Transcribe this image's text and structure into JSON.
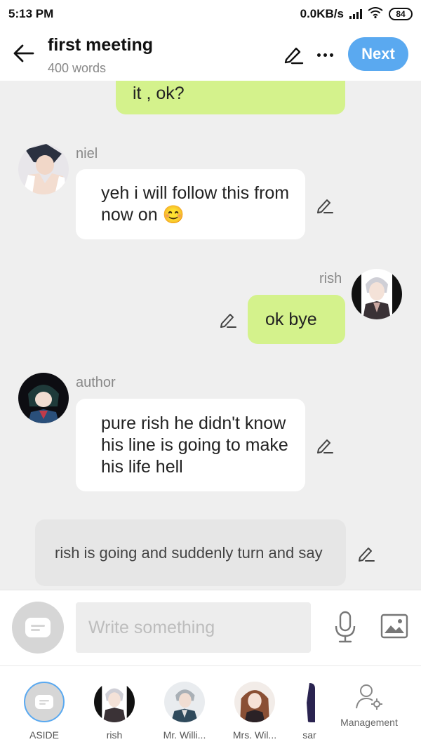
{
  "status": {
    "time": "5:13 PM",
    "network": "0.0KB/s",
    "battery": "84"
  },
  "header": {
    "title": "first meeting",
    "word_count": "400 words",
    "next_label": "Next"
  },
  "messages": [
    {
      "kind": "me",
      "text": "it , ok?"
    },
    {
      "kind": "other",
      "speaker": "niel",
      "text": "yeh i will follow this from now on",
      "emoji": "😊"
    },
    {
      "kind": "me",
      "speaker": "rish",
      "text": "ok bye"
    },
    {
      "kind": "other",
      "speaker": "author",
      "text": "pure rish he didn't know his line is going to make his life hell"
    },
    {
      "kind": "aside",
      "text": "rish is going and suddenly turn and say"
    }
  ],
  "composer": {
    "placeholder": "Write something"
  },
  "characters": [
    {
      "label": "ASIDE"
    },
    {
      "label": "rish"
    },
    {
      "label": "Mr. Willi..."
    },
    {
      "label": "Mrs. Wil..."
    },
    {
      "label": "sar"
    }
  ],
  "management_label": "Management",
  "colors": {
    "accent": "#5aa9f0",
    "my_bubble": "#d4f28c",
    "other_bubble": "#ffffff",
    "aside_bubble": "#e6e6e6"
  }
}
